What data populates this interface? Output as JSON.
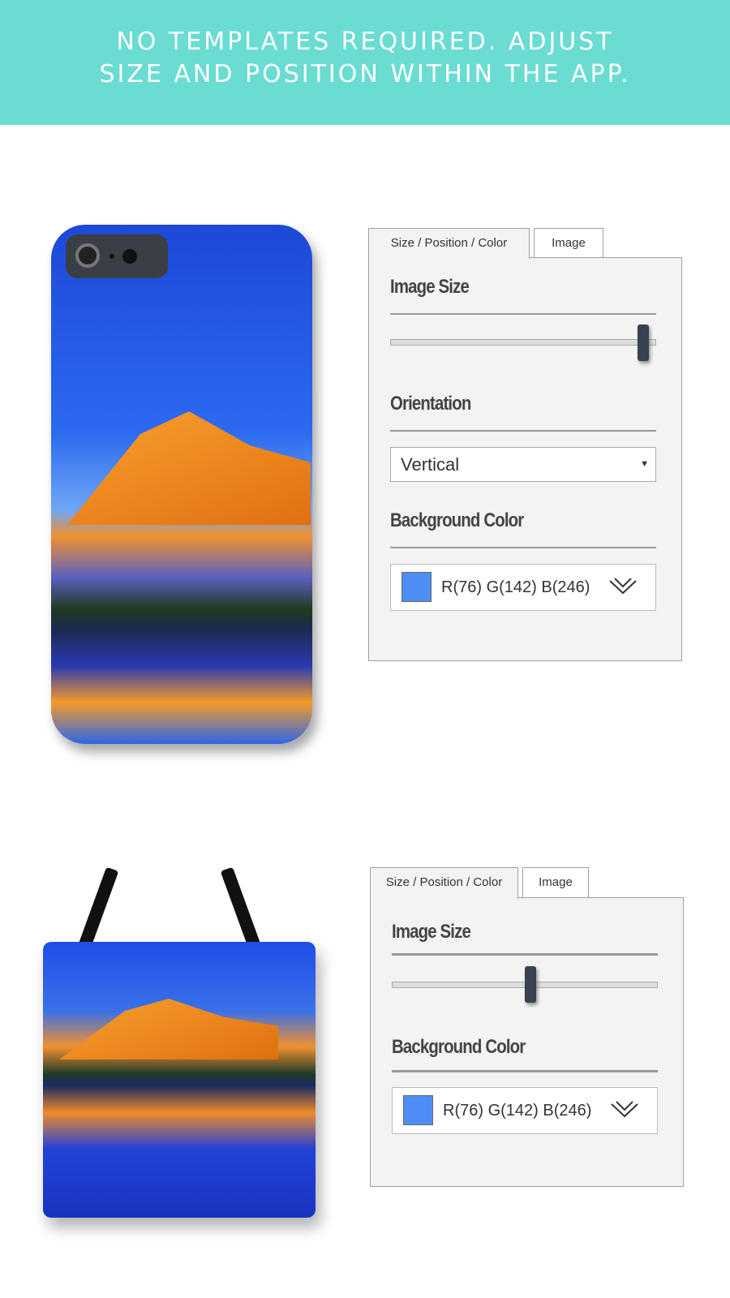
{
  "banner": {
    "line1": "NO TEMPLATES REQUIRED. ADJUST",
    "line2": "SIZE AND POSITION WITHIN THE APP."
  },
  "panels": [
    {
      "tabs": [
        "Size / Position / Color",
        "Image"
      ],
      "image_size_label": "Image Size",
      "image_size_value": 0.95,
      "orientation_label": "Orientation",
      "orientation_value": "Vertical",
      "bg_color_label": "Background Color",
      "bg_color_text": "R(76) G(142) B(246)",
      "bg_color": "#4c8ef6"
    },
    {
      "tabs": [
        "Size / Position / Color",
        "Image"
      ],
      "image_size_label": "Image Size",
      "image_size_value": 0.52,
      "bg_color_label": "Background Color",
      "bg_color_text": "R(76) G(142) B(246)",
      "bg_color": "#4c8ef6"
    }
  ],
  "colors": {
    "banner": "#6adcd2",
    "slider_thumb": "#37414f"
  }
}
